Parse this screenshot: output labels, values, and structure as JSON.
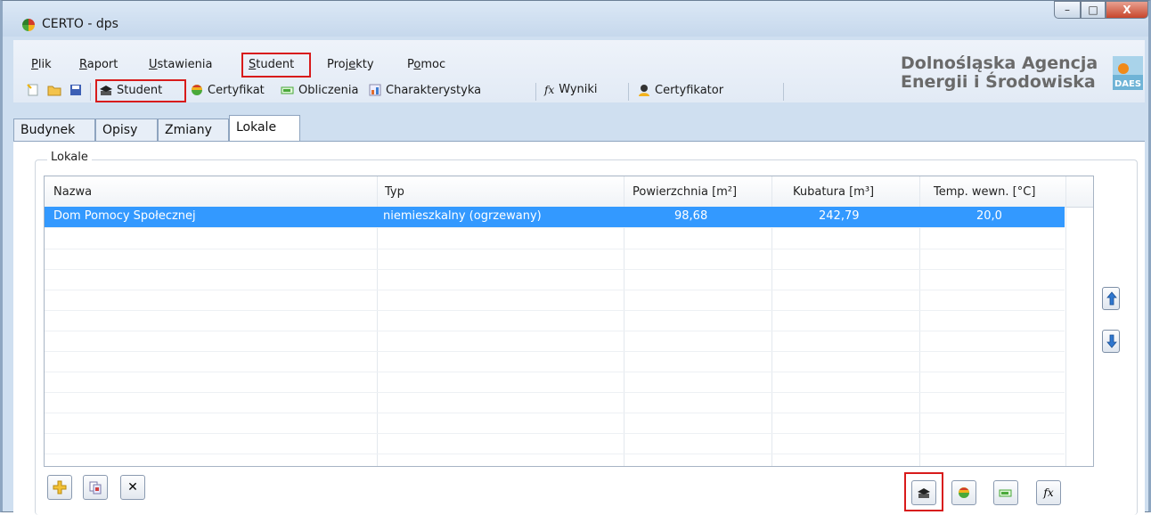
{
  "window": {
    "title": "CERTO - dps",
    "controls": {
      "minimize": "–",
      "maximize": "□",
      "close": "X"
    }
  },
  "menu": {
    "items": [
      {
        "id": "plik",
        "label": "Plik"
      },
      {
        "id": "raport",
        "label": "Raport"
      },
      {
        "id": "ustawienia",
        "label": "Ustawienia"
      },
      {
        "id": "student",
        "label": "Student"
      },
      {
        "id": "projekty",
        "label": "Projekty"
      },
      {
        "id": "pomoc",
        "label": "Pomoc"
      }
    ]
  },
  "toolbar": {
    "student": "Student",
    "certyfikat": "Certyfikat",
    "obliczenia": "Obliczenia",
    "charakterystyka": "Charakterystyka",
    "wyniki": "Wyniki",
    "certyfikator": "Certyfikator",
    "fx_glyph": "fx"
  },
  "brand": {
    "line1": "Dolnośląska Agencja",
    "line2": "Energii i Środowiska",
    "logo_text": "DAES"
  },
  "tabs": [
    "Budynek",
    "Opisy",
    "Zmiany",
    "Lokale"
  ],
  "group": {
    "label": "Lokale"
  },
  "table": {
    "columns": [
      "Nazwa",
      "Typ",
      "Powierzchnia [m²]",
      "Kubatura [m³]",
      "Temp. wewn. [°C]"
    ],
    "rows": [
      {
        "nazwa": "Dom Pomocy Społecznej",
        "typ": "niemieszkalny (ogrzewany)",
        "powierzchnia": "98,68",
        "kubatura": "242,79",
        "temp": "20,0",
        "selected": true
      }
    ]
  },
  "bottom_buttons": {
    "delete_glyph": "✕",
    "fx_glyph": "fx"
  },
  "colors": {
    "selection": "#3399ff",
    "highlight_box": "#d81b1b",
    "window_frame": "#cfdff0"
  }
}
